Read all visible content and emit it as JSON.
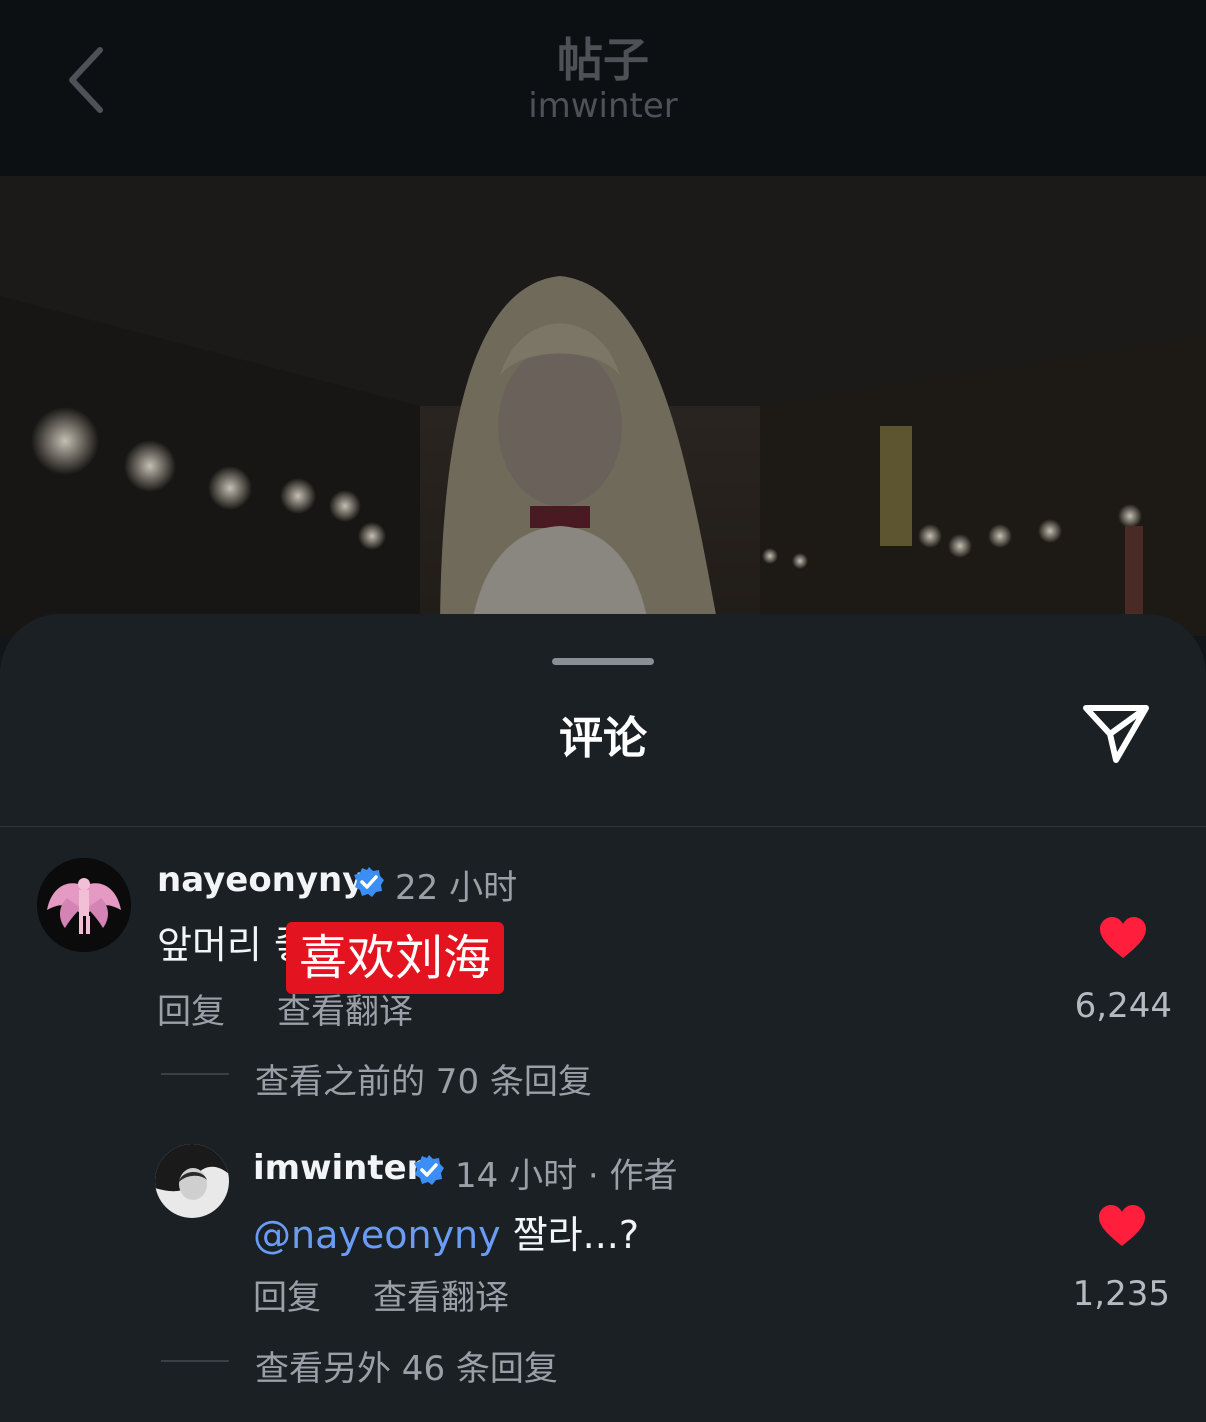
{
  "header": {
    "title": "帖子",
    "subtitle": "imwinter"
  },
  "sheet": {
    "title": "评论"
  },
  "comments": [
    {
      "username": "nayeonyny",
      "time": "22 小时",
      "text": "앞머리 좋다",
      "reply_label": "回复",
      "translate_label": "查看翻译",
      "likes": "6,244",
      "view_replies": "查看之前的 70 条回复"
    },
    {
      "username": "imwinter",
      "time": "14 小时 · 作者",
      "mention": "@nayeonyny",
      "text": " 짤라...?",
      "reply_label": "回复",
      "translate_label": "查看翻译",
      "likes": "1,235",
      "view_replies": "查看另外 46 条回复"
    }
  ],
  "overlay": {
    "label": "喜欢刘海"
  },
  "colors": {
    "heart": "#ff1f3d",
    "verified": "#3a8ef6",
    "mention": "#6a9cf5",
    "overlay": "#e3131f"
  }
}
